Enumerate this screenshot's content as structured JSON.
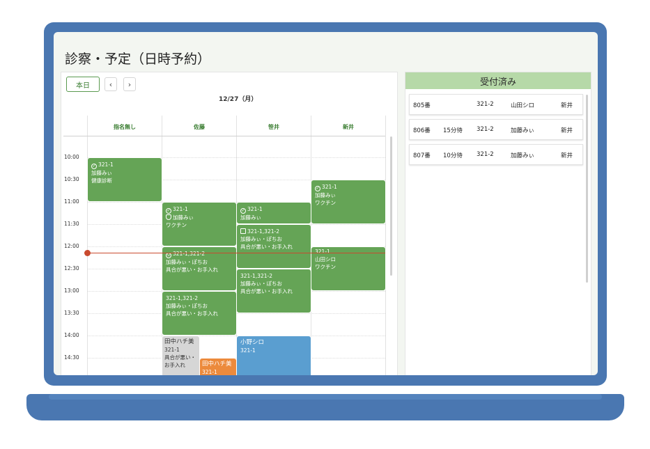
{
  "window": {
    "dots": "· · ·"
  },
  "page": {
    "title": "診察・予定（日時予約）"
  },
  "calendar": {
    "today_label": "本日",
    "prev_label": "‹",
    "next_label": "›",
    "date": "12/27（月）",
    "columns": [
      "指名無し",
      "佐藤",
      "笹井",
      "新井"
    ],
    "times": [
      "10:00",
      "10:30",
      "11:00",
      "11:30",
      "12:00",
      "12:30",
      "13:00",
      "13:30",
      "14:00",
      "14:30"
    ],
    "events": [
      {
        "lines": [
          "321-1",
          "加藤みぃ",
          "健康診断"
        ],
        "icon": "check-circle-icon",
        "status": "green"
      },
      {
        "lines": [
          "321-1",
          "加藤みぃ",
          "ワクチン"
        ],
        "icon": "check-circle-icon",
        "status": "green"
      },
      {
        "lines": [
          "321-1",
          "加藤みぃ",
          "ワクチン"
        ],
        "icon": "shield-icon",
        "status": "green"
      },
      {
        "lines": [
          "321-1",
          "加藤みぃ"
        ],
        "icon": "check-circle-icon",
        "status": "green"
      },
      {
        "lines": [
          "321-1,321-2",
          "加藤みぃ・ぽちお",
          "具合が悪い・お手入れ"
        ],
        "icon": "bed-icon",
        "status": "green"
      },
      {
        "lines": [
          "321-1",
          "山田シロ",
          "ワクチン"
        ],
        "icon": "",
        "status": "green"
      },
      {
        "lines": [
          "321-1,321-2",
          "加藤みぃ・ぽちお",
          "具合が悪い・お手入れ"
        ],
        "icon": "stethoscope-icon",
        "status": "green"
      },
      {
        "lines": [
          "321-1,321-2",
          "加藤みぃ・ぽちお",
          "具合が悪い・お手入れ"
        ],
        "icon": "",
        "status": "green"
      },
      {
        "lines": [
          "321-1,321-2",
          "加藤みぃ・ぽちお",
          "具合が悪い・お手入れ"
        ],
        "icon": "",
        "status": "green"
      },
      {
        "lines": [
          "田中ハチ美",
          "321-1",
          "具合が悪い・",
          "お手入れ"
        ],
        "icon": "",
        "status": "gray"
      },
      {
        "lines": [
          "田中ハチ美",
          "321-1"
        ],
        "icon": "",
        "status": "orange"
      },
      {
        "lines": [
          "小野シロ",
          "321-1"
        ],
        "icon": "",
        "status": "blue"
      }
    ]
  },
  "reception": {
    "title": "受付済み",
    "rows": [
      {
        "number": "805番",
        "wait": "",
        "id": "321-2",
        "name": "山田シロ",
        "doctor": "新井"
      },
      {
        "number": "806番",
        "wait": "15分待",
        "id": "321-2",
        "name": "加藤みぃ",
        "doctor": "新井"
      },
      {
        "number": "807番",
        "wait": "10分待",
        "id": "321-2",
        "name": "加藤みぃ",
        "doctor": "新井"
      }
    ]
  },
  "colors": {
    "frame": "#4a77b1",
    "accent": "#3a7d31",
    "event_green": "#65a456",
    "event_blue": "#5a9ed0",
    "event_orange": "#ec8a3c",
    "event_gray": "#d6d6d6",
    "now_line": "#c94a2e",
    "header_green": "#b6d9a8"
  }
}
